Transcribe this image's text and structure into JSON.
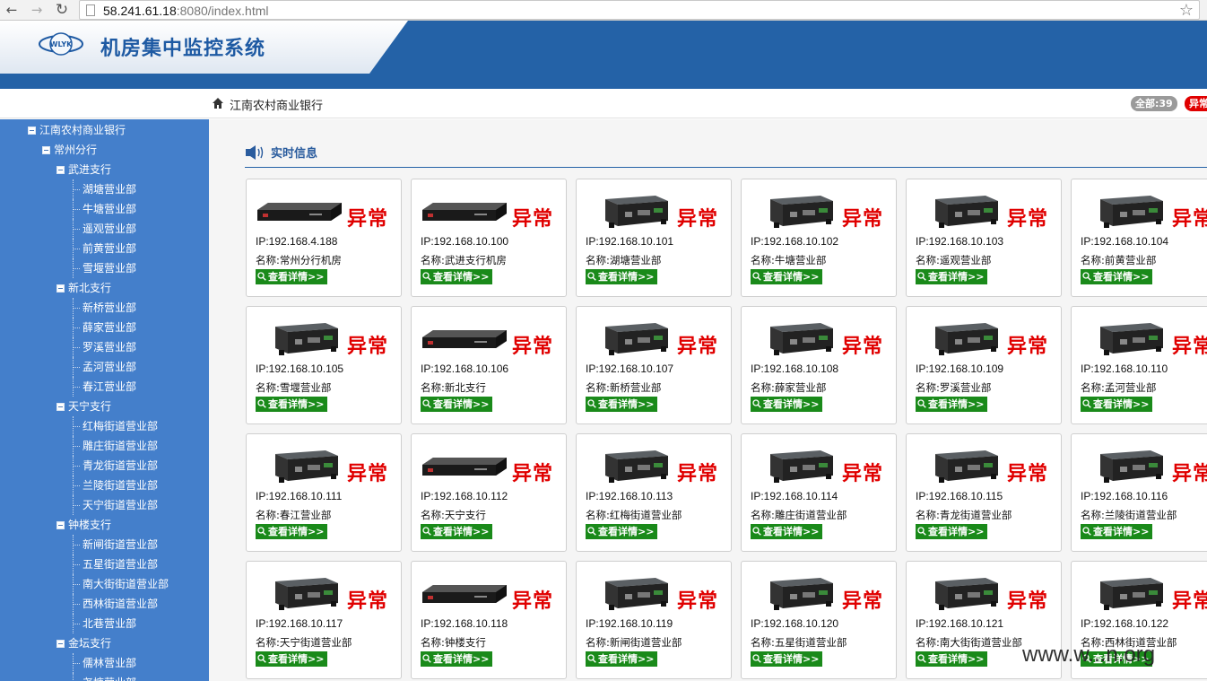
{
  "browser": {
    "url_host": "58.241.61.18",
    "url_rest": ":8080/index.html",
    "back_icon": "back-arrow-icon",
    "forward_icon": "forward-arrow-icon",
    "reload_icon": "reload-icon",
    "star_icon": "star-icon"
  },
  "header": {
    "title": "机房集中监控系统",
    "logo_text": "WLYK",
    "brand_color": "#2462a7"
  },
  "breadcrumb": {
    "text": "江南农村商业银行",
    "icon": "home-icon"
  },
  "badges": {
    "all": "全部:39",
    "abnormal": "异常"
  },
  "section": {
    "title": "实时信息",
    "icon": "speaker-icon"
  },
  "tree": [
    {
      "label": "江南农村商业银行",
      "level": 0,
      "toggle": true
    },
    {
      "label": "常州分行",
      "level": 1,
      "toggle": true
    },
    {
      "label": "武进支行",
      "level": 2,
      "toggle": true
    },
    {
      "label": "湖塘营业部",
      "level": 3
    },
    {
      "label": "牛塘营业部",
      "level": 3
    },
    {
      "label": "遥观营业部",
      "level": 3
    },
    {
      "label": "前黄营业部",
      "level": 3
    },
    {
      "label": "雪堰营业部",
      "level": 3
    },
    {
      "label": "新北支行",
      "level": 2,
      "toggle": true
    },
    {
      "label": "新桥营业部",
      "level": 3
    },
    {
      "label": "薛家营业部",
      "level": 3
    },
    {
      "label": "罗溪营业部",
      "level": 3
    },
    {
      "label": "孟河营业部",
      "level": 3
    },
    {
      "label": "春江营业部",
      "level": 3
    },
    {
      "label": "天宁支行",
      "level": 2,
      "toggle": true
    },
    {
      "label": "红梅街道营业部",
      "level": 3
    },
    {
      "label": "雕庄街道营业部",
      "level": 3
    },
    {
      "label": "青龙街道营业部",
      "level": 3
    },
    {
      "label": "兰陵街道营业部",
      "level": 3
    },
    {
      "label": "天宁街道营业部",
      "level": 3
    },
    {
      "label": "钟楼支行",
      "level": 2,
      "toggle": true
    },
    {
      "label": "新闸街道营业部",
      "level": 3
    },
    {
      "label": "五星街道营业部",
      "level": 3
    },
    {
      "label": "南大街街道营业部",
      "level": 3
    },
    {
      "label": "西林街道营业部",
      "level": 3
    },
    {
      "label": "北巷营业部",
      "level": 3
    },
    {
      "label": "金坛支行",
      "level": 2,
      "toggle": true
    },
    {
      "label": "儒林营业部",
      "level": 3
    },
    {
      "label": "尧塘营业部",
      "level": 3
    }
  ],
  "detail_label": "查看详情>>",
  "ip_prefix": "IP:",
  "name_prefix": "名称:",
  "status_color": "#e00000",
  "devices": [
    {
      "ip": "192.168.4.188",
      "name": "常州分行机房",
      "status": "异常",
      "type": "rack"
    },
    {
      "ip": "192.168.10.100",
      "name": "武进支行机房",
      "status": "异常",
      "type": "rack"
    },
    {
      "ip": "192.168.10.101",
      "name": "湖塘营业部",
      "status": "异常",
      "type": "box"
    },
    {
      "ip": "192.168.10.102",
      "name": "牛塘营业部",
      "status": "异常",
      "type": "box"
    },
    {
      "ip": "192.168.10.103",
      "name": "遥观营业部",
      "status": "异常",
      "type": "box"
    },
    {
      "ip": "192.168.10.104",
      "name": "前黄营业部",
      "status": "异常",
      "type": "box"
    },
    {
      "ip": "192.168.10.105",
      "name": "雪堰营业部",
      "status": "异常",
      "type": "box"
    },
    {
      "ip": "192.168.10.106",
      "name": "新北支行",
      "status": "异常",
      "type": "rack"
    },
    {
      "ip": "192.168.10.107",
      "name": "新桥营业部",
      "status": "异常",
      "type": "box"
    },
    {
      "ip": "192.168.10.108",
      "name": "薛家营业部",
      "status": "异常",
      "type": "box"
    },
    {
      "ip": "192.168.10.109",
      "name": "罗溪营业部",
      "status": "异常",
      "type": "box"
    },
    {
      "ip": "192.168.10.110",
      "name": "孟河营业部",
      "status": "异常",
      "type": "box"
    },
    {
      "ip": "192.168.10.111",
      "name": "春江营业部",
      "status": "异常",
      "type": "box"
    },
    {
      "ip": "192.168.10.112",
      "name": "天宁支行",
      "status": "异常",
      "type": "rack"
    },
    {
      "ip": "192.168.10.113",
      "name": "红梅街道营业部",
      "status": "异常",
      "type": "box"
    },
    {
      "ip": "192.168.10.114",
      "name": "雕庄街道营业部",
      "status": "异常",
      "type": "box"
    },
    {
      "ip": "192.168.10.115",
      "name": "青龙街道营业部",
      "status": "异常",
      "type": "box"
    },
    {
      "ip": "192.168.10.116",
      "name": "兰陵街道营业部",
      "status": "异常",
      "type": "box"
    },
    {
      "ip": "192.168.10.117",
      "name": "天宁街道营业部",
      "status": "异常",
      "type": "box"
    },
    {
      "ip": "192.168.10.118",
      "name": "钟楼支行",
      "status": "异常",
      "type": "rack"
    },
    {
      "ip": "192.168.10.119",
      "name": "新闸街道营业部",
      "status": "异常",
      "type": "box"
    },
    {
      "ip": "192.168.10.120",
      "name": "五星街道营业部",
      "status": "异常",
      "type": "box"
    },
    {
      "ip": "192.168.10.121",
      "name": "南大街街道营业部",
      "status": "异常",
      "type": "box"
    },
    {
      "ip": "192.168.10.122",
      "name": "西林街道营业部",
      "status": "异常",
      "type": "box"
    }
  ],
  "watermark": "www.w...n.org"
}
